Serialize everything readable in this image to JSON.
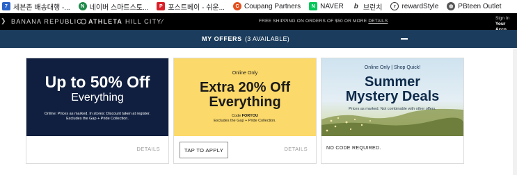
{
  "bookmarks": [
    {
      "label": "세븐존 배송대행 -...",
      "icon": "sevenzone-icon",
      "color": "#2a64c8"
    },
    {
      "label": "네이버 스마트스토...",
      "icon": "naver-smartstore-icon",
      "color": "#1f8a4a"
    },
    {
      "label": "포스트베이 - 쉬운...",
      "icon": "postbay-icon",
      "color": "#d9202a"
    },
    {
      "label": "Coupang Partners",
      "icon": "coupang-icon",
      "color": "#e2501d"
    },
    {
      "label": "NAVER",
      "icon": "naver-icon",
      "color": "#03c75a"
    },
    {
      "label": "브런치",
      "icon": "brunch-icon",
      "color": "#333333"
    },
    {
      "label": "rewardStyle",
      "icon": "rewardstyle-icon",
      "color": "#333333"
    },
    {
      "label": "PBteen Outlet",
      "icon": "globe-icon",
      "color": "#555555"
    }
  ],
  "brands": {
    "banana": "BANANA REPUBLIC",
    "athleta": "ATHLETA",
    "hillcity": "HILL CITY"
  },
  "shipping": {
    "text": "FREE SHIPPING ON ORDERS OF $50 OR MORE",
    "link": "DETAILS"
  },
  "account": {
    "signin": "Sign In",
    "your_account": "Your Acco"
  },
  "offers_bar": {
    "title": "MY OFFERS",
    "available": "(3 AVAILABLE)"
  },
  "offers": [
    {
      "kicker": "",
      "headline_1": "Up to 50% Off",
      "headline_2": "Everything",
      "code_label": "",
      "code": "",
      "fine_1": "Online: Prices as marked. In stores: Discount taken at register.",
      "fine_2": "Excludes the Gap + Pride Collection.",
      "action": "",
      "details": "DETAILS",
      "banner_color": "#101f3f"
    },
    {
      "kicker": "Online Only",
      "headline_1": "Extra 20% Off",
      "headline_2": "Everything",
      "code_label": "Code",
      "code": "FORYOU",
      "fine_1": "Excludes the Gap + Pride Collection.",
      "fine_2": "",
      "action": "TAP TO APPLY",
      "details": "DETAILS",
      "banner_color": "#fbd96a"
    },
    {
      "kicker": "Online Only | Shop Quick!",
      "headline_1": "Summer",
      "headline_2": "Mystery Deals",
      "code_label": "",
      "code": "",
      "fine_1": "Prices as marked. Not combinable with other offers.",
      "fine_2": "",
      "action": "NO CODE REQUIRED.",
      "details": "",
      "banner_color": "#cfe3f0"
    }
  ]
}
